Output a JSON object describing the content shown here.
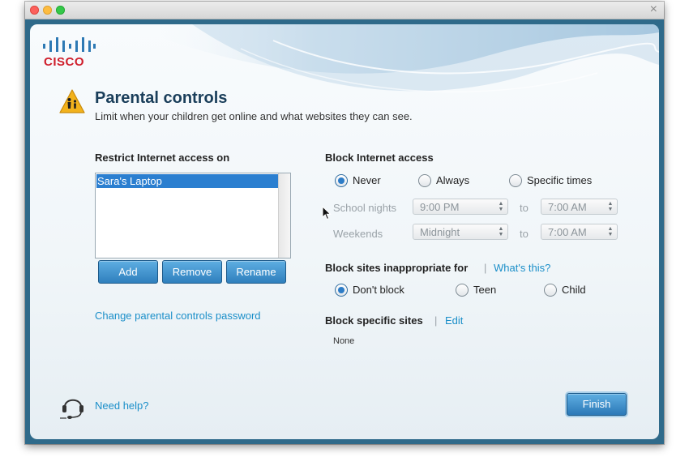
{
  "window": {
    "close_glyph": "×"
  },
  "brand": {
    "logo_text": "CISCO",
    "accent_color": "#cf1d2a"
  },
  "header": {
    "icon": "warning-children-icon",
    "title": "Parental controls",
    "subtitle": "Limit when your children get online and what websites they can see."
  },
  "restrict": {
    "label": "Restrict Internet access on",
    "devices": [
      "Sara's Laptop"
    ],
    "selected": "Sara's Laptop",
    "buttons": {
      "add": "Add",
      "remove": "Remove",
      "rename": "Rename"
    },
    "change_password_link": "Change parental controls password"
  },
  "block_access": {
    "label": "Block Internet access",
    "options": [
      "Never",
      "Always",
      "Specific times"
    ],
    "selected": "Never",
    "school_nights": {
      "label": "School nights",
      "from": "9:00 PM",
      "to_label": "to",
      "to": "7:00 AM"
    },
    "weekends": {
      "label": "Weekends",
      "from": "Midnight",
      "to_label": "to",
      "to": "7:00 AM"
    }
  },
  "block_sites": {
    "label": "Block sites inappropriate for",
    "separator": "|",
    "whats_this_link": "What's this?",
    "options": [
      "Don't block",
      "Teen",
      "Child"
    ],
    "selected": "Don't block"
  },
  "specific_sites": {
    "label": "Block specific sites",
    "separator": "|",
    "edit_link": "Edit",
    "value": "None"
  },
  "footer": {
    "help_icon": "headset-icon",
    "help_link": "Need help?",
    "finish_button": "Finish"
  },
  "colors": {
    "link": "#1b8fc9",
    "button_blue": "#2f7fbd",
    "title": "#1a3e5a"
  }
}
